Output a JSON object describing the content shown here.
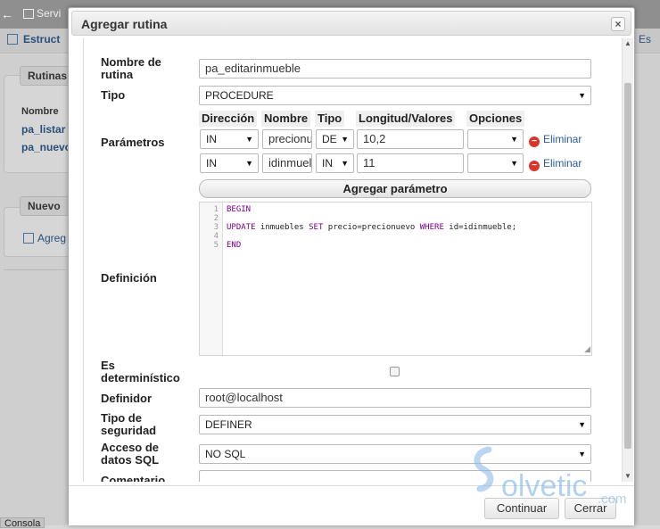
{
  "background": {
    "back_glyph": "←",
    "server_label": "Servi",
    "struct_label": "Estruct",
    "right_tab_label": "Es",
    "rutinas_legend": "Rutinas",
    "nombre_header": "Nombre",
    "rows": [
      "pa_listar",
      "pa_nuevo"
    ],
    "nuevo_legend": "Nuevo",
    "agregar_link": "Agreg",
    "console_label": "Consola"
  },
  "dialog": {
    "title": "Agregar rutina",
    "close_glyph": "×",
    "nombre_label": "Nombre de rutina",
    "nombre_value": "pa_editarinmueble",
    "tipo_label": "Tipo",
    "tipo_value": "PROCEDURE",
    "parametros_label": "Parámetros",
    "param_headers": [
      "Dirección",
      "Nombre",
      "Tipo",
      "Longitud/Valores",
      "Opciones"
    ],
    "params": [
      {
        "direction": "IN",
        "name": "precionu",
        "type": "DE",
        "length": "10,2",
        "options": "",
        "delete_label": "Eliminar"
      },
      {
        "direction": "IN",
        "name": "idinmuel",
        "type": "IN",
        "length": "11",
        "options": "",
        "delete_label": "Eliminar"
      }
    ],
    "add_param_label": "Agregar parámetro",
    "definicion_label": "Definición",
    "code_lines": [
      {
        "num": "1",
        "text": "BEGIN"
      },
      {
        "num": "2",
        "text": ""
      },
      {
        "num": "3",
        "text": "UPDATE inmuebles SET precio=precionuevo WHERE id=idinmueble;"
      },
      {
        "num": "4",
        "text": ""
      },
      {
        "num": "5",
        "text": "END"
      }
    ],
    "deterministic_label": "Es determinístico",
    "definidor_label": "Definidor",
    "definidor_value": "root@localhost",
    "seguridad_label": "Tipo de seguridad",
    "seguridad_value": "DEFINER",
    "acceso_label": "Acceso de datos SQL",
    "acceso_value": "NO SQL",
    "comentario_label": "Comentario",
    "comentario_value": "",
    "continuar_label": "Continuar",
    "cerrar_label": "Cerrar"
  },
  "watermark": {
    "text": "olvetic",
    "suffix": ".com"
  }
}
